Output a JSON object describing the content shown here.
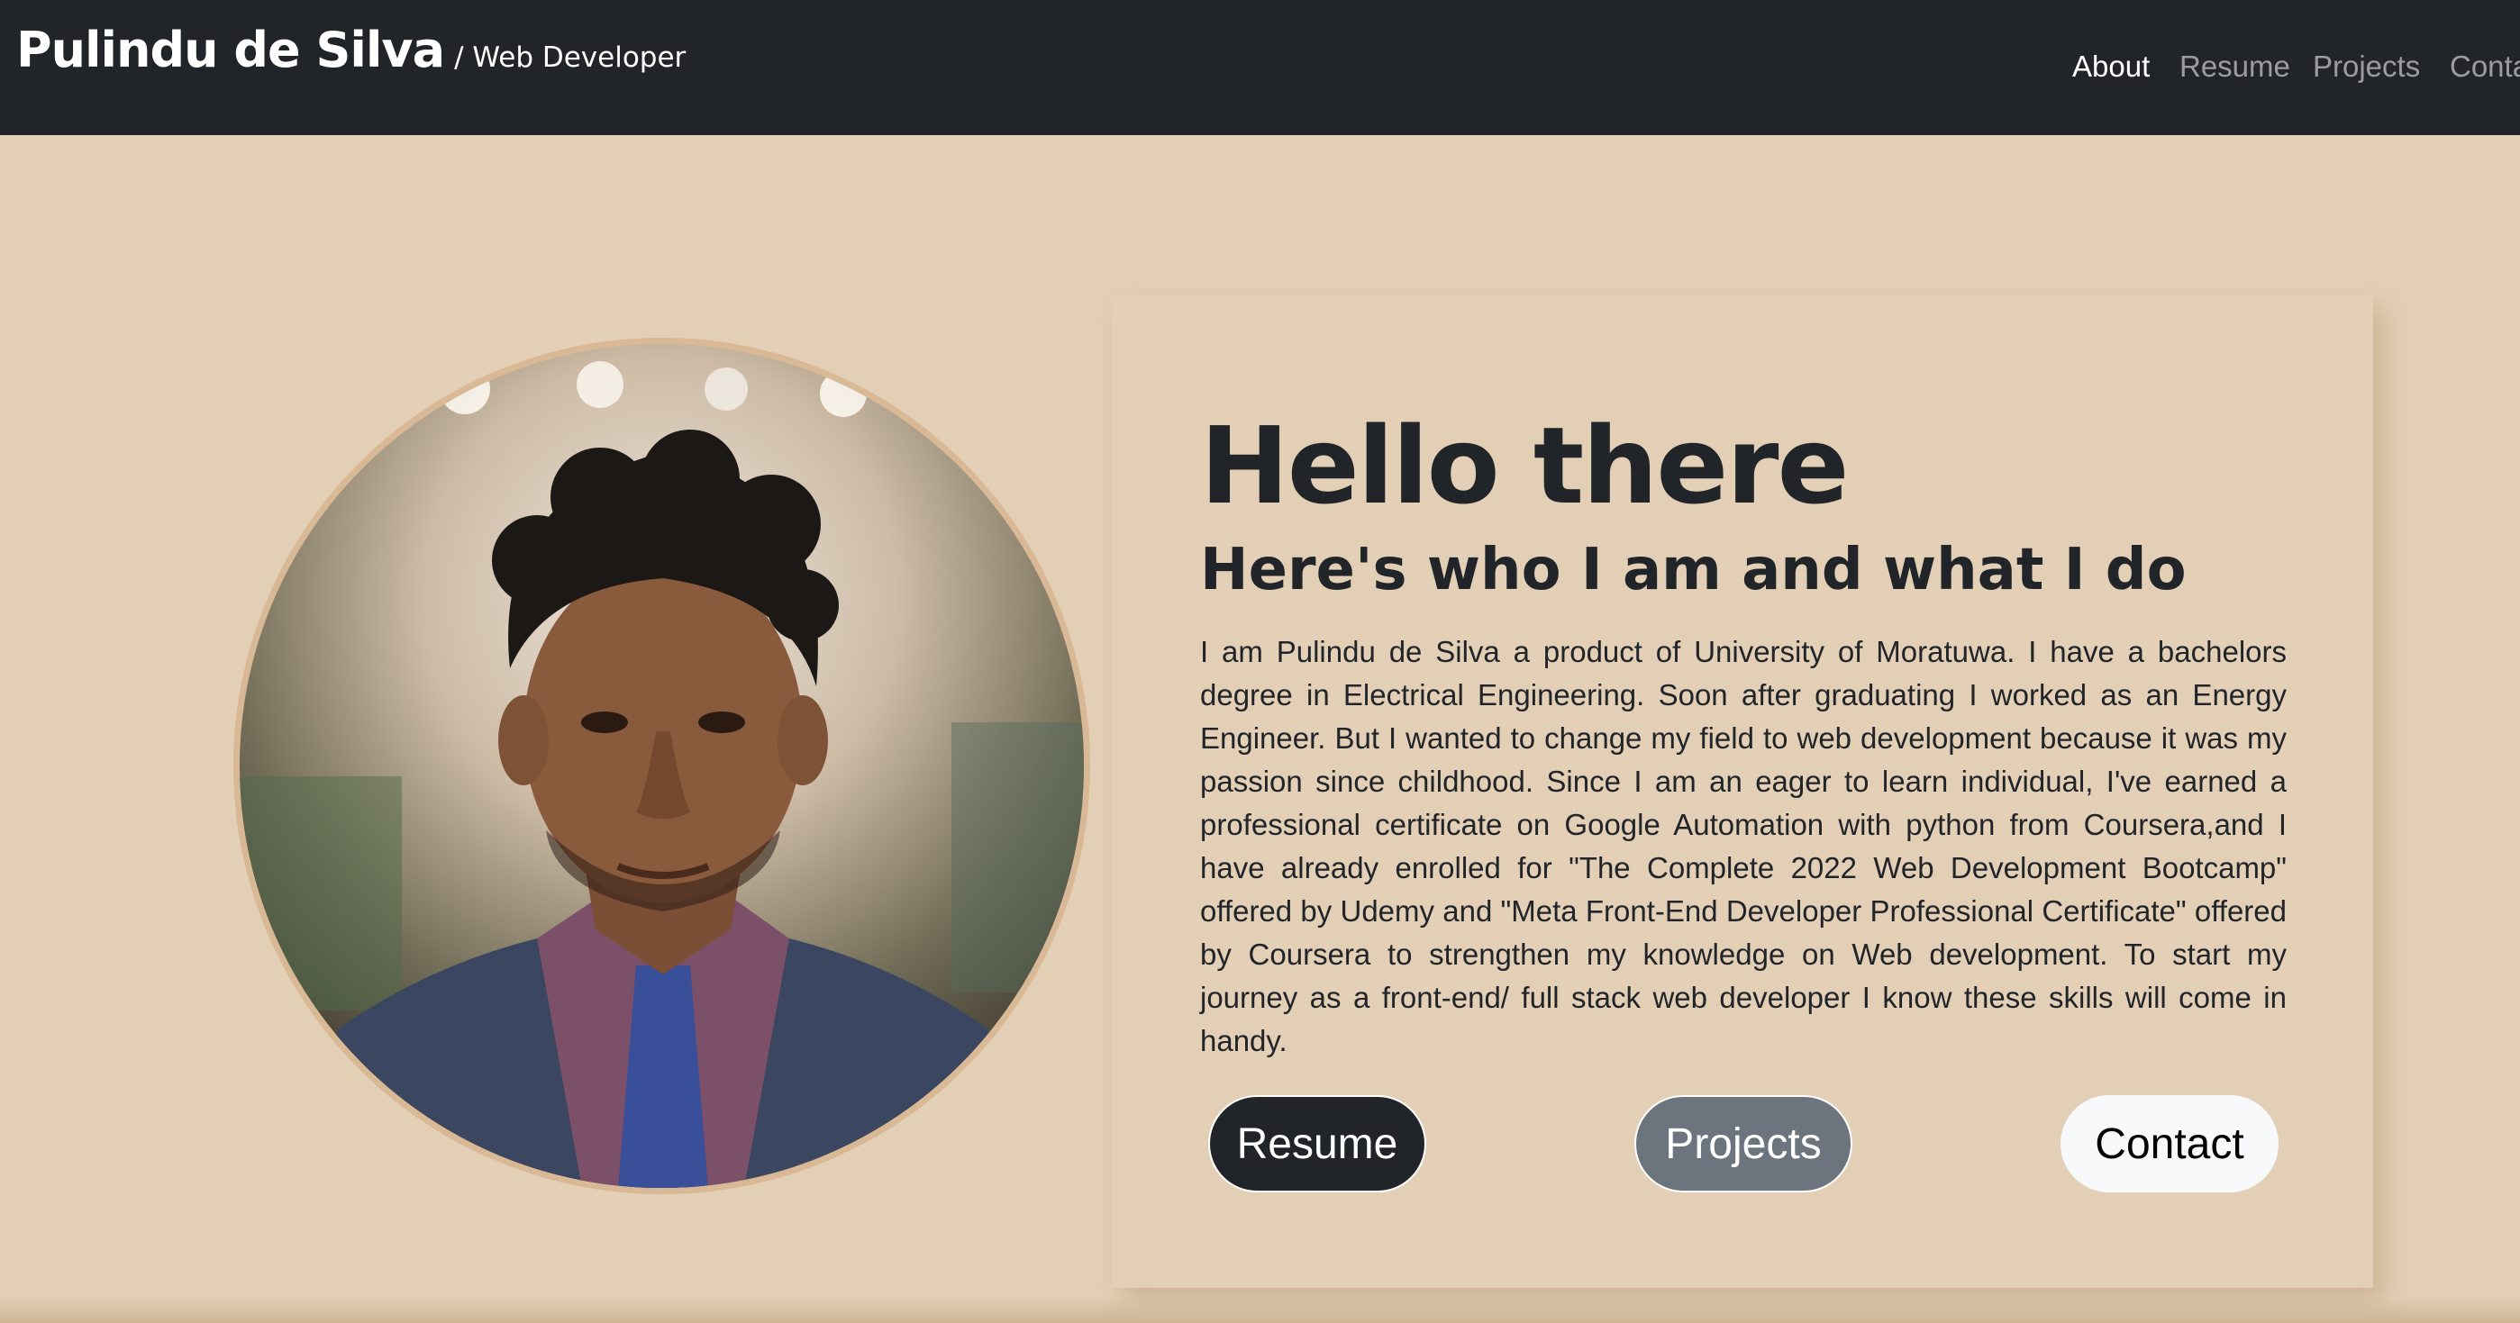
{
  "navbar": {
    "brand_name": "Pulindu de Silva",
    "brand_subtitle": "/ Web Developer",
    "links": [
      {
        "label": "About",
        "active": true
      },
      {
        "label": "Resume",
        "active": false
      },
      {
        "label": "Projects",
        "active": false
      },
      {
        "label": "Contact",
        "active": false
      }
    ]
  },
  "hero": {
    "headline": "Hello there",
    "subheadline": "Here's who I am and what I do",
    "bio": "I am Pulindu de Silva a product of University of Moratuwa. I have a bachelors degree in Electrical Engineering. Soon after graduating I worked as an Energy Engineer. But I wanted to change my field to web development because it was my passion since childhood. Since I am an eager to learn individual, I've earned a professional certificate on Google Automation with python from Coursera,and I have already enrolled for \"The Complete 2022 Web Development Bootcamp\" offered by Udemy and \"Meta Front-End Developer Professional Certificate\" offered by Coursera to strengthen my knowledge on Web development. To start my journey as a front-end/ full stack web developer I know these skills will come in handy.",
    "buttons": {
      "resume": "Resume",
      "projects": "Projects",
      "contact": "Contact"
    }
  },
  "colors": {
    "navbar_bg": "#212529",
    "page_bg": "#e2cfb5",
    "photo_ring": "#d9b896",
    "btn_dark": "#212529",
    "btn_secondary": "#6c757d",
    "btn_light": "#f8f9fa"
  }
}
